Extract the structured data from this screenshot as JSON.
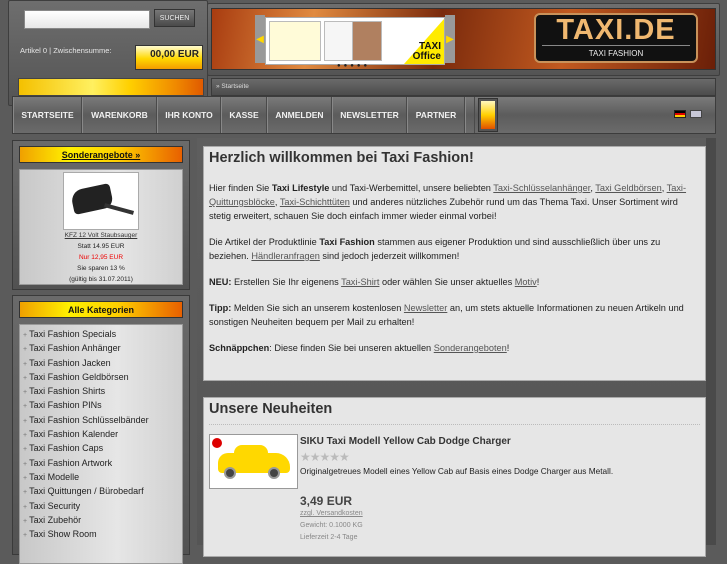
{
  "search": {
    "placeholder": "",
    "button": "SUCHEN"
  },
  "cart": {
    "label": "Artikel 0 | Zwischensumme:",
    "total": "00,00 EUR"
  },
  "banner": {
    "slide_text_1": "TAXI",
    "slide_text_2": "Office",
    "logo": "TAXI.DE",
    "logo_sub": "TAXI FASHION"
  },
  "breadcrumb": "» Startseite",
  "nav": [
    "STARTSEITE",
    "WARENKORB",
    "IHR KONTO",
    "KASSE",
    "ANMELDEN",
    "NEWSLETTER",
    "PARTNER"
  ],
  "languages": [
    "de",
    "en"
  ],
  "specials": {
    "title": "Sonderangebote »",
    "product": "KFZ 12 Volt Staubsauger",
    "old_price": "Statt 14.95 EUR",
    "new_price": "Nur 12,95 EUR",
    "savings": "Sie sparen 13 %",
    "valid": "(gültig bis 31.07.2011)"
  },
  "categories": {
    "title": "Alle Kategorien",
    "items": [
      "Taxi Fashion Specials",
      "Taxi Fashion Anhänger",
      "Taxi Fashion Jacken",
      "Taxi Fashion Geldbörsen",
      "Taxi Fashion Shirts",
      "Taxi Fashion PINs",
      "Taxi Fashion Schlüsselbänder",
      "Taxi Fashion Kalender",
      "Taxi Fashion Caps",
      "Taxi Fashion Artwork",
      "Taxi Modelle",
      "Taxi Quittungen / Bürobedarf",
      "Taxi Security",
      "Taxi Zubehör",
      "Taxi Show Room"
    ]
  },
  "welcome": {
    "title": "Herzlich willkommen bei Taxi Fashion!",
    "p1": {
      "a": "Hier finden Sie ",
      "b": "Taxi Lifestyle",
      "c": " und Taxi-Werbemittel, unsere beliebten ",
      "l1": "Taxi-Schlüsselanhänger",
      "s1": ", ",
      "l2": "Taxi Geldbörsen",
      "s2": ", ",
      "l3": "Taxi-Quittungsblöcke",
      "s3": ", ",
      "l4": "Taxi-Schichttüten",
      "d": " und anderes nützliches Zubehör rund um das Thema Taxi. Unser Sortiment wird stetig erweitert, schauen Sie doch einfach immer wieder einmal vorbei!"
    },
    "p2": {
      "a": "Die Artikel der Produktlinie ",
      "b": "Taxi Fashion",
      "c": " stammen aus eigener Produktion und sind ausschließlich über uns zu beziehen. ",
      "l1": "Händleranfragen",
      "d": " sind jedoch jederzeit willkommen!"
    },
    "p3": {
      "b": "NEU:",
      "a": " Erstellen Sie Ihr eigenens ",
      "l1": "Taxi-Shirt",
      "c": " oder wählen Sie unser aktuelles ",
      "l2": "Motiv",
      "d": "!"
    },
    "p4": {
      "b": "Tipp:",
      "a": " Melden Sie sich an unserem kostenlosen ",
      "l1": "Newsletter",
      "d": " an, um stets aktuelle Informationen zu neuen Artikeln und sonstigen Neuheiten bequem per Mail zu erhalten!"
    },
    "p5": {
      "b": "Schnäppchen",
      "a": ": Diese finden Sie bei unseren aktuellen ",
      "l1": "Sonderangeboten",
      "d": "!"
    }
  },
  "news": {
    "title": "Unsere Neuheiten",
    "product": {
      "name": "SIKU Taxi Modell Yellow Cab Dodge Charger",
      "rating": 0,
      "stars_max": 5,
      "stars": "★★★★★",
      "description": "Originalgetreues Modell eines Yellow Cab auf Basis eines Dodge Charger aus Metall.",
      "price": "3,49 EUR",
      "shipping": "zzgl. Versandkosten",
      "weight": "Gewicht: 0.1000 KG",
      "delivery": "Lieferzeit 2-4 Tage"
    }
  }
}
